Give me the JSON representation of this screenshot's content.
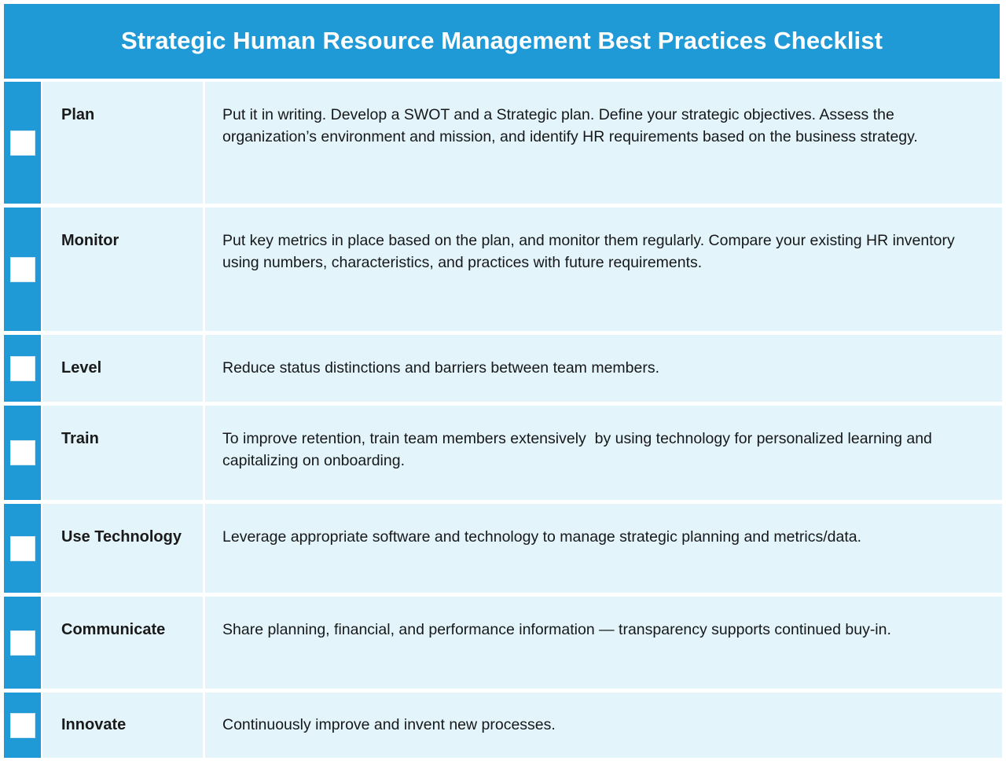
{
  "header": {
    "title": "Strategic Human Resource Management Best Practices Checklist",
    "background_color": "#1f9ad6",
    "text_color": "#ffffff"
  },
  "theme": {
    "accent_blue": "#1f9ad6",
    "cell_background": "#e3f4fb",
    "page_background": "#ffffff",
    "body_text_color": "#16181a",
    "checkbox_fill": "#ffffff"
  },
  "checklist": {
    "checkbox_state": "unchecked",
    "rows": [
      {
        "label": "Plan",
        "description": "Put it in writing. Develop a SWOT and a Strategic plan. Define your strategic objectives. Assess the organization’s environment and mission, and identify HR requirements based on the business strategy."
      },
      {
        "label": "Monitor",
        "description": "Put key metrics in place based on the plan, and monitor them regularly. Compare your existing HR inventory using numbers, characteristics, and practices with future requirements."
      },
      {
        "label": "Level",
        "description": "Reduce status distinctions and barriers between team members."
      },
      {
        "label": "Train",
        "description": "To improve retention, train team members extensively  by using technology for personalized learning and capitalizing on onboarding."
      },
      {
        "label": "Use Technology",
        "description": "Leverage appropriate software and technology to manage strategic planning and metrics/data."
      },
      {
        "label": "Communicate",
        "description": "Share planning, financial, and performance information — transparency supports continued buy-in."
      },
      {
        "label": "Innovate",
        "description": "Continuously improve and invent new processes."
      }
    ]
  }
}
